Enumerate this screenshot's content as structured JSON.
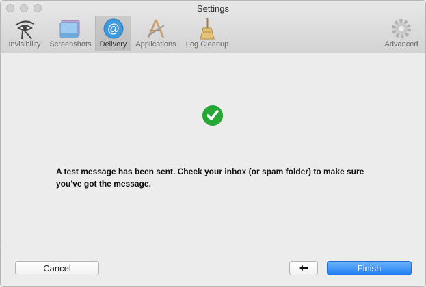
{
  "window": {
    "title": "Settings"
  },
  "toolbar": {
    "items": [
      {
        "label": "Invisibility",
        "icon": "eye-of-horus-icon"
      },
      {
        "label": "Screenshots",
        "icon": "screenshots-icon"
      },
      {
        "label": "Delivery",
        "icon": "at-sign-icon"
      },
      {
        "label": "Applications",
        "icon": "applications-icon"
      },
      {
        "label": "Log Cleanup",
        "icon": "broom-icon"
      },
      {
        "label": "Advanced",
        "icon": "gear-icon"
      }
    ],
    "selected": "Delivery"
  },
  "main": {
    "status_icon": "checkmark-icon",
    "message": "A test message has been sent. Check your inbox (or spam folder) to make sure you've got the message."
  },
  "footer": {
    "cancel_label": "Cancel",
    "back_label": "🡐",
    "finish_label": "Finish"
  },
  "colors": {
    "accent": "#1f7ef3",
    "success": "#27a836"
  }
}
